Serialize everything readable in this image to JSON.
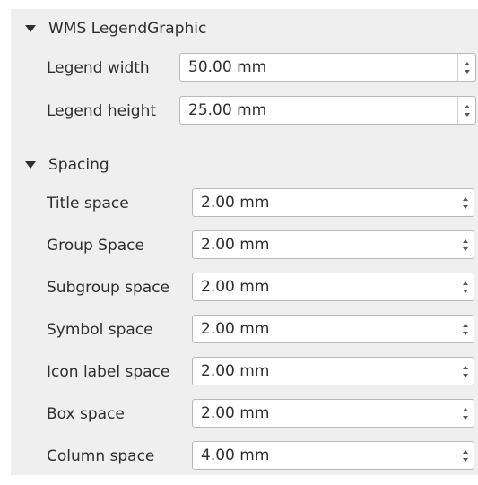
{
  "wms_legend_graphic": {
    "title": "WMS LegendGraphic",
    "fields": [
      {
        "label": "Legend width",
        "value": "50.00 mm"
      },
      {
        "label": "Legend height",
        "value": "25.00 mm"
      }
    ]
  },
  "spacing": {
    "title": "Spacing",
    "fields": [
      {
        "label": "Title space",
        "value": "2.00 mm"
      },
      {
        "label": "Group Space",
        "value": "2.00 mm"
      },
      {
        "label": "Subgroup space",
        "value": "2.00 mm"
      },
      {
        "label": "Symbol space",
        "value": "2.00 mm"
      },
      {
        "label": "Icon label space",
        "value": "2.00 mm"
      },
      {
        "label": "Box space",
        "value": "2.00 mm"
      },
      {
        "label": "Column space",
        "value": "4.00 mm"
      }
    ]
  }
}
